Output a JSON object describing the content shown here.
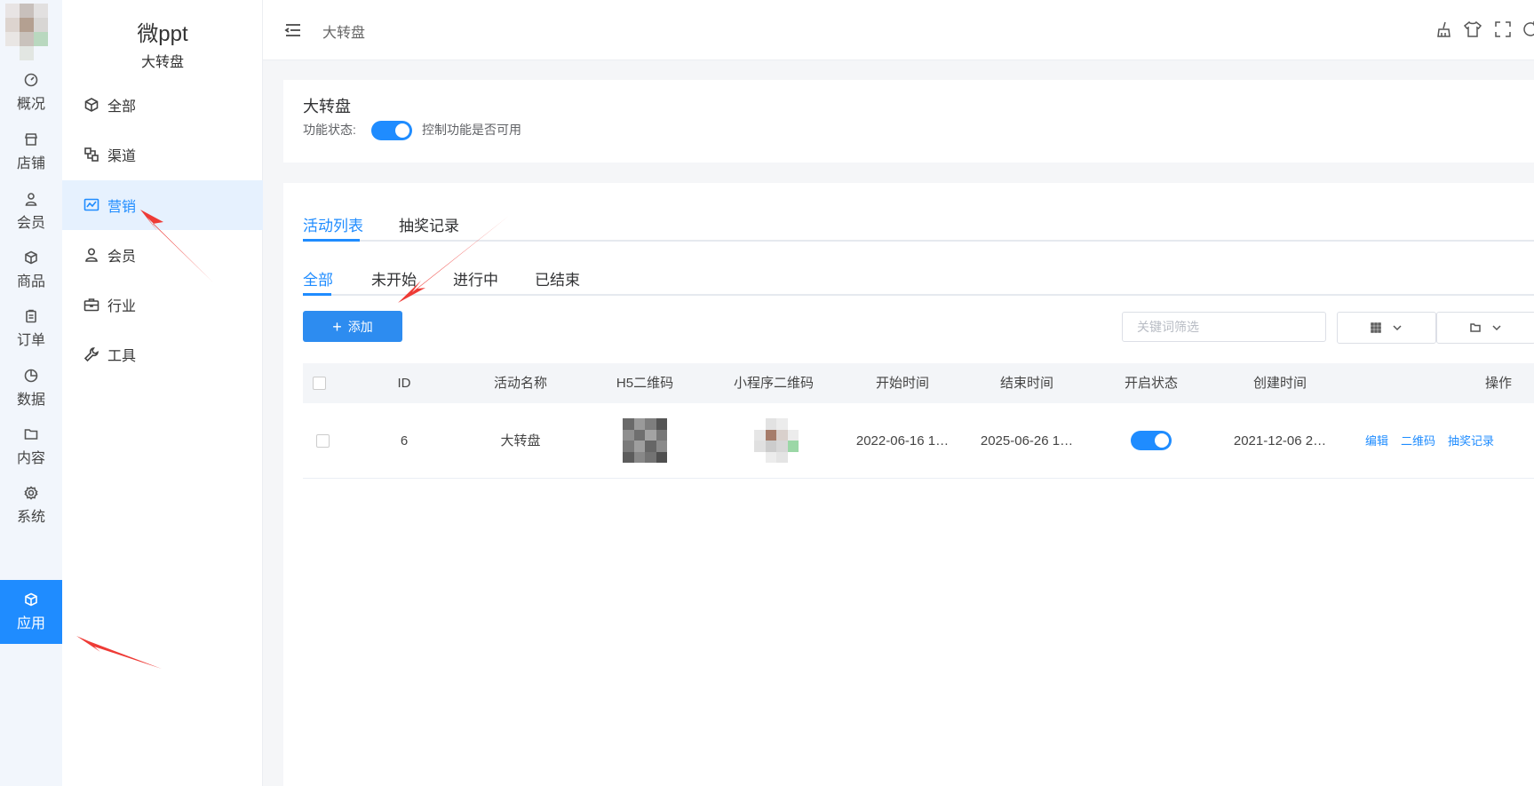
{
  "rail": {
    "items": [
      {
        "label": "概况",
        "icon": "dashboard-icon"
      },
      {
        "label": "店铺",
        "icon": "store-icon"
      },
      {
        "label": "会员",
        "icon": "user-icon"
      },
      {
        "label": "商品",
        "icon": "box-icon"
      },
      {
        "label": "订单",
        "icon": "clipboard-icon"
      },
      {
        "label": "数据",
        "icon": "pie-chart-icon"
      },
      {
        "label": "内容",
        "icon": "folder-icon"
      },
      {
        "label": "系统",
        "icon": "gear-icon"
      },
      {
        "label": "应用",
        "icon": "cube-icon",
        "active": true
      }
    ]
  },
  "brand": {
    "title": "微ppt",
    "subtitle": "大转盘"
  },
  "subnav": {
    "items": [
      {
        "label": "全部",
        "icon": "cube-icon"
      },
      {
        "label": "渠道",
        "icon": "channel-icon"
      },
      {
        "label": "营销",
        "icon": "monitor-chart-icon",
        "active": true
      },
      {
        "label": "会员",
        "icon": "user-icon"
      },
      {
        "label": "行业",
        "icon": "briefcase-icon"
      },
      {
        "label": "工具",
        "icon": "wrench-icon"
      }
    ]
  },
  "header": {
    "breadcrumb": "大转盘",
    "icons": [
      "broom-icon",
      "shirt-icon",
      "fullscreen-icon",
      "refresh-icon"
    ]
  },
  "status": {
    "title": "大转盘",
    "label": "功能状态:",
    "enabled": true,
    "description": "控制功能是否可用"
  },
  "tabs": [
    "活动列表",
    "抽奖记录"
  ],
  "sub_tabs": [
    "全部",
    "未开始",
    "进行中",
    "已结束"
  ],
  "toolbar": {
    "add_label": "添加",
    "search_placeholder": "关键词筛选"
  },
  "table": {
    "columns": [
      "ID",
      "活动名称",
      "H5二维码",
      "小程序二维码",
      "开始时间",
      "结束时间",
      "开启状态",
      "创建时间",
      "操作"
    ],
    "rows": [
      {
        "id": "6",
        "name": "大转盘",
        "start": "2022-06-16 1…",
        "end": "2025-06-26 1…",
        "enabled": true,
        "created": "2021-12-06 2…",
        "actions": [
          "编辑",
          "二维码",
          "抽奖记录"
        ]
      }
    ]
  },
  "colors": {
    "accent": "#1f8cff",
    "annotation": "#ee3b36"
  }
}
